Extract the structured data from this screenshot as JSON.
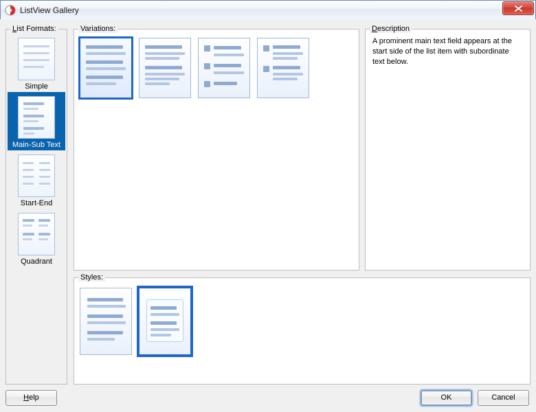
{
  "window": {
    "title": "ListView Gallery"
  },
  "panels": {
    "formats_label_pre": "L",
    "formats_label_rest": "ist Formats:",
    "variations_label": "Variations:",
    "description_label_pre": "D",
    "description_label_rest": "escription",
    "styles_label": "Styles:"
  },
  "formats": {
    "items": [
      {
        "label": "Simple",
        "selected": false
      },
      {
        "label": "Main-Sub Text",
        "selected": true
      },
      {
        "label": "Start-End",
        "selected": false
      },
      {
        "label": "Quadrant",
        "selected": false
      }
    ]
  },
  "variations": {
    "count": 4,
    "selected_index": 0
  },
  "styles": {
    "count": 2,
    "selected_index": 1
  },
  "description": {
    "text": "A prominent main text field appears at the start side of the list item with subordinate text below."
  },
  "buttons": {
    "help_pre": "H",
    "help_rest": "elp",
    "ok": "OK",
    "cancel": "Cancel"
  }
}
